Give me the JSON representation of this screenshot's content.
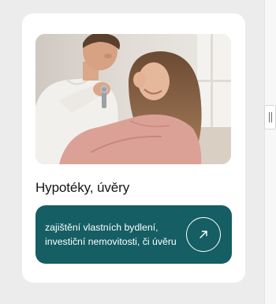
{
  "card": {
    "image": {
      "subject": "couple-holding-house-keys-photo"
    },
    "title": "Hypotéky, úvěry",
    "cta": {
      "text": "zajištění vlastních bydlení, investiční nemovitosti, či úvěru",
      "icon": "arrow-up-right-icon"
    }
  },
  "colors": {
    "page_background": "#ececec",
    "card_background": "#ffffff",
    "cta_background": "#155e63",
    "cta_text": "#ffffff",
    "title_text": "#151515"
  }
}
